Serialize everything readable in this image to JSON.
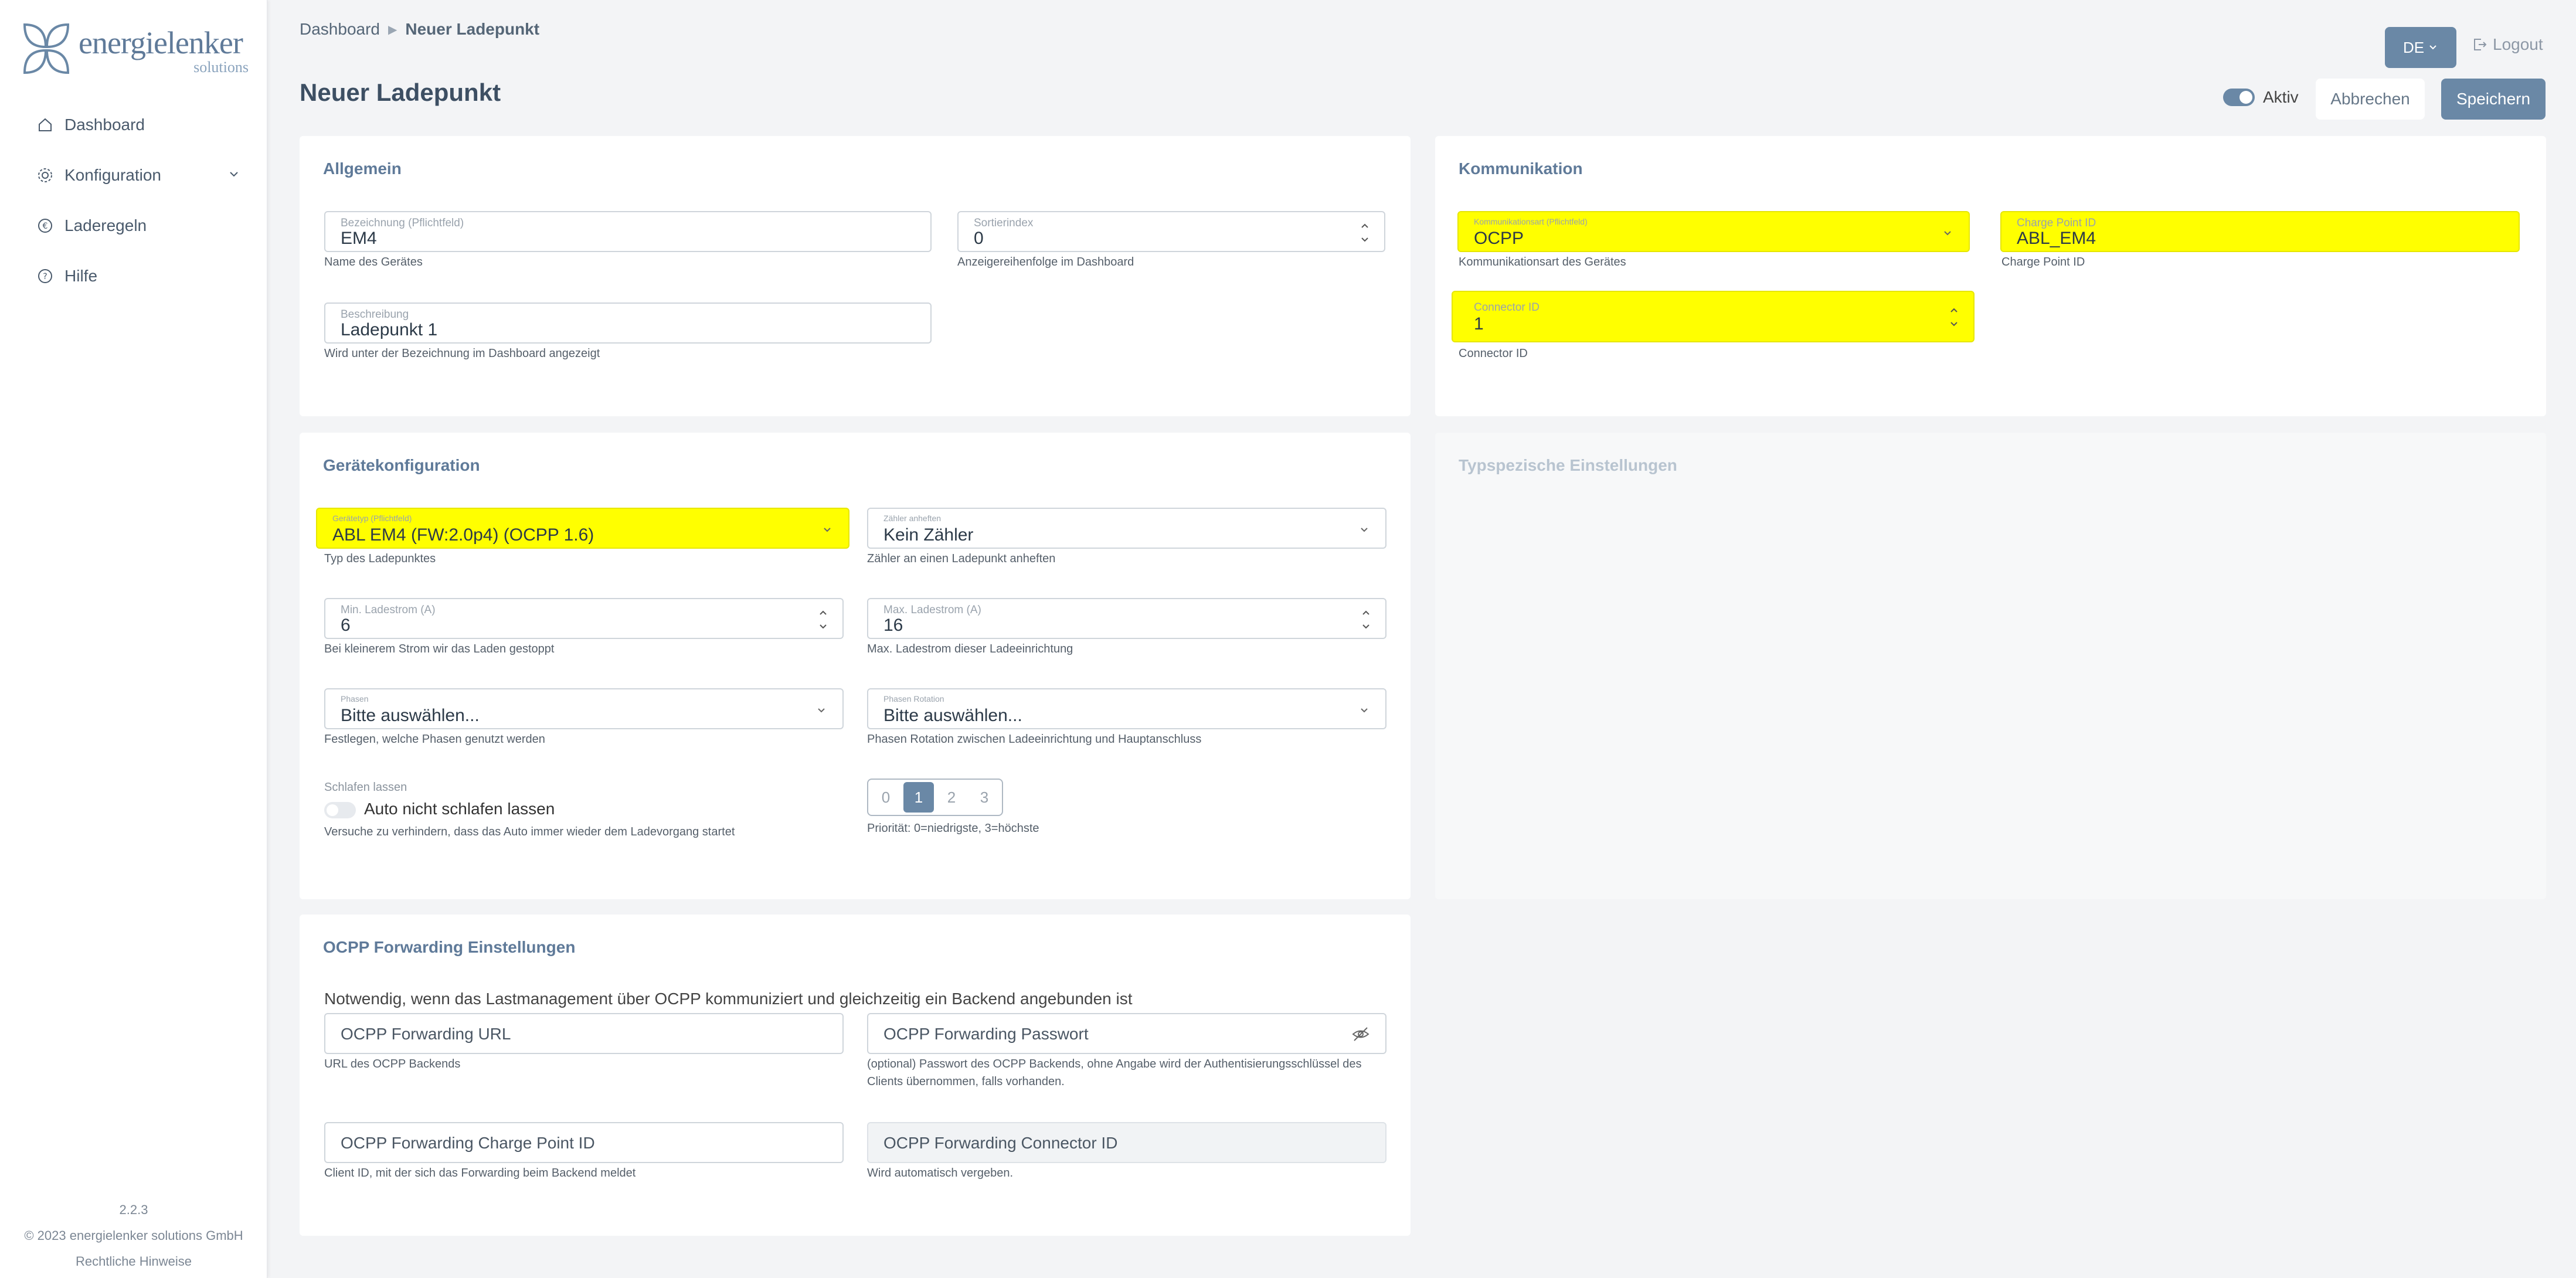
{
  "brand": {
    "name": "energielenker",
    "sub": "solutions",
    "colors": {
      "accent": "#6a88a6",
      "logo": "#5f7a99",
      "highlight": "#ffff00"
    }
  },
  "sidebar": {
    "items": [
      {
        "label": "Dashboard",
        "icon": "home-icon"
      },
      {
        "label": "Konfiguration",
        "icon": "gear-icon"
      },
      {
        "label": "Laderegeln",
        "icon": "euro-icon"
      },
      {
        "label": "Hilfe",
        "icon": "help-icon"
      }
    ],
    "version": "2.2.3",
    "copyright": "© 2023 energielenker solutions GmbH",
    "legal": "Rechtliche Hinweise"
  },
  "header": {
    "breadcrumb": [
      "Dashboard",
      "Neuer Ladepunkt"
    ],
    "title": "Neuer Ladepunkt",
    "lang": "DE",
    "logout": "Logout",
    "active_label": "Aktiv",
    "cancel": "Abbrechen",
    "save": "Speichern"
  },
  "allgemein": {
    "title": "Allgemein",
    "bezeichnung": {
      "label": "Bezeichnung (Pflichtfeld)",
      "value": "EM4",
      "help": "Name des Gerätes"
    },
    "sortierindex": {
      "label": "Sortierindex",
      "value": "0",
      "help": "Anzeigereihenfolge im Dashboard"
    },
    "beschreibung": {
      "label": "Beschreibung",
      "value": "Ladepunkt 1",
      "help": "Wird unter der Bezeichnung im Dashboard angezeigt"
    }
  },
  "kommunikation": {
    "title": "Kommunikation",
    "art": {
      "label": "Kommunikationsart (Pflichtfeld)",
      "value": "OCPP",
      "help": "Kommunikationsart des Gerätes"
    },
    "chargepoint": {
      "label": "Charge Point ID",
      "value": "ABL_EM4",
      "help": "Charge Point ID"
    },
    "connector": {
      "label": "Connector ID",
      "value": "1",
      "help": "Connector ID"
    }
  },
  "geraet": {
    "title": "Gerätekonfiguration",
    "typ": {
      "label": "Gerätetyp (Pflichtfeld)",
      "value": "ABL EM4 (FW:2.0p4) (OCPP 1.6)",
      "help": "Typ des Ladepunktes"
    },
    "zaehler": {
      "label": "Zähler anheften",
      "value": "Kein Zähler",
      "help": "Zähler an einen Ladepunkt anheften"
    },
    "min": {
      "label": "Min. Ladestrom (A)",
      "value": "6",
      "help": "Bei kleinerem Strom wir das Laden gestoppt"
    },
    "max": {
      "label": "Max. Ladestrom (A)",
      "value": "16",
      "help": "Max. Ladestrom dieser Ladeeinrichtung"
    },
    "phasen": {
      "label": "Phasen",
      "value": "Bitte auswählen...",
      "help": "Festlegen, welche Phasen genutzt werden"
    },
    "rotation": {
      "label": "Phasen Rotation",
      "value": "Bitte auswählen...",
      "help": "Phasen Rotation zwischen Ladeeinrichtung und Hauptanschluss"
    },
    "schlafen": {
      "label": "Schlafen lassen",
      "switch": "Auto nicht schlafen lassen",
      "help": "Versuche zu verhindern, dass das Auto immer wieder dem Ladevorgang startet"
    },
    "prio": {
      "options": [
        "0",
        "1",
        "2",
        "3"
      ],
      "selected": "1",
      "help": "Priorität: 0=niedrigste, 3=höchste"
    }
  },
  "typ": {
    "title": "Typspezische Einstellungen"
  },
  "ocpp": {
    "title": "OCPP Forwarding Einstellungen",
    "notice": "Notwendig, wenn das Lastmanagement über OCPP kommuniziert und gleichzeitig ein Backend angebunden ist",
    "url": {
      "placeholder": "OCPP Forwarding URL",
      "help": "URL des OCPP Backends"
    },
    "pw": {
      "placeholder": "OCPP Forwarding Passwort",
      "help1": "(optional) Passwort des OCPP Backends, ohne Angabe wird der Authentisierungsschlüssel des",
      "help2": "Clients übernommen, falls vorhanden."
    },
    "cpid": {
      "placeholder": "OCPP Forwarding Charge Point ID",
      "help": "Client ID, mit der sich das Forwarding beim Backend meldet"
    },
    "conn": {
      "placeholder": "OCPP Forwarding Connector ID",
      "help": "Wird automatisch vergeben."
    }
  }
}
